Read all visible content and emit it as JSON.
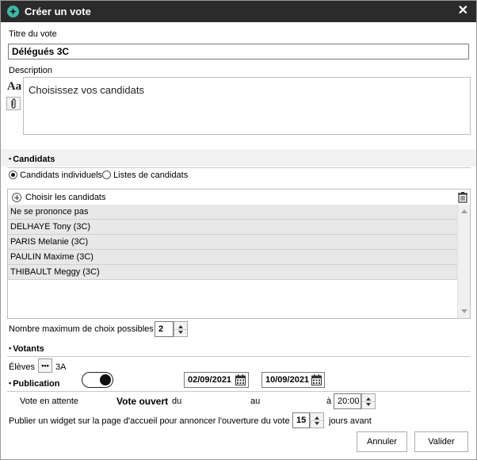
{
  "window": {
    "title": "Créer un vote",
    "close_glyph": "✕"
  },
  "title_field": {
    "label": "Titre du vote",
    "value": "Délégués 3C"
  },
  "description": {
    "label": "Description",
    "value": "Choisissez vos candidats",
    "format_icon_text": "Aa"
  },
  "candidats": {
    "section_title": "Candidats",
    "options": [
      {
        "label": "Candidats individuels",
        "selected": true
      },
      {
        "label": "Listes de candidats",
        "selected": false
      }
    ],
    "choose_label": "Choisir les candidats",
    "rows": [
      "Ne se prononce pas",
      "DELHAYE Tony (3C)",
      "PARIS Melanie (3C)",
      "PAULIN Maxime (3C)",
      "THIBAULT Meggy (3C)"
    ]
  },
  "max_choices": {
    "label": "Nombre maximum de choix possibles",
    "value": "2"
  },
  "votants": {
    "section_title": "Votants",
    "label": "Élèves",
    "dots": "•••",
    "value": "3A"
  },
  "publication": {
    "section_title": "Publication",
    "pending_label": "Vote en attente",
    "open_label": "Vote ouvert",
    "from_label": "du",
    "from_date": "02/09/2021",
    "to_label": "au",
    "to_date": "10/09/2021",
    "at_label": "à",
    "time": "20:00",
    "widget_text": "Publier un widget sur la page d'accueil pour annoncer l'ouverture du vote",
    "widget_days": "15",
    "days_label": "jours avant"
  },
  "buttons": {
    "cancel": "Annuler",
    "validate": "Valider"
  },
  "colors": {
    "titlebar": "#2b2b2b",
    "app_icon": "#3fb7a3",
    "row_bg": "#e8e8e8"
  }
}
